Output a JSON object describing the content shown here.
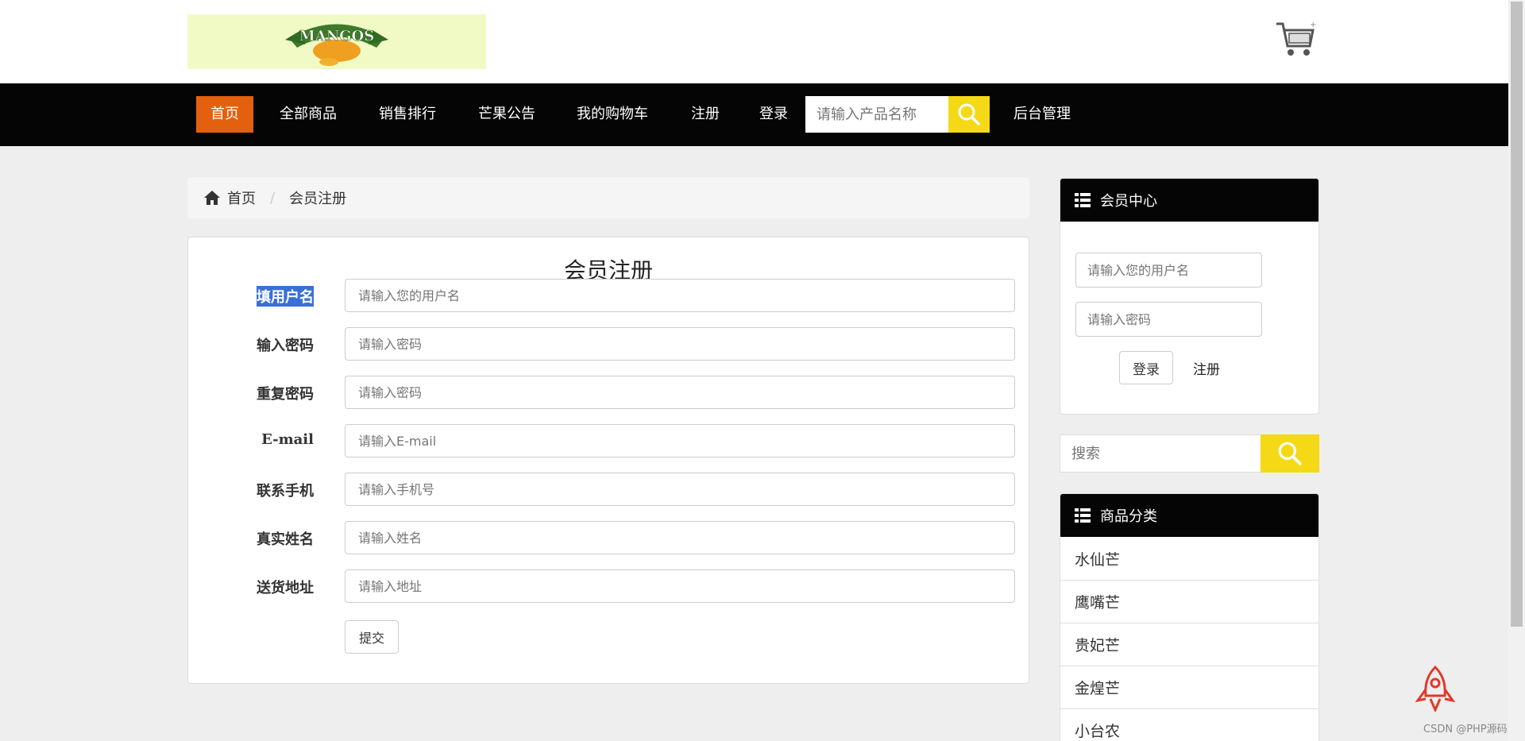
{
  "header": {
    "logo_text": "MANGOS",
    "cart_icon": "shopping-cart-icon"
  },
  "nav": {
    "items": [
      "首页",
      "全部商品",
      "销售排行",
      "芒果公告",
      "我的购物车",
      "注册",
      "登录"
    ],
    "search_placeholder": "请输入产品名称",
    "admin_label": "后台管理",
    "accent_color": "#e3600e",
    "search_button_color": "#f5d916"
  },
  "breadcrumb": {
    "home": "首页",
    "current": "会员注册"
  },
  "register": {
    "title": "会员注册",
    "fields": [
      {
        "label": "填用户名",
        "placeholder": "请输入您的用户名"
      },
      {
        "label": "输入密码",
        "placeholder": "请输入密码"
      },
      {
        "label": "重复密码",
        "placeholder": "请输入密码"
      },
      {
        "label": "E-mail",
        "placeholder": "请输入E-mail"
      },
      {
        "label": "联系手机",
        "placeholder": "请输入手机号"
      },
      {
        "label": "真实姓名",
        "placeholder": "请输入姓名"
      },
      {
        "label": "送货地址",
        "placeholder": "请输入地址"
      }
    ],
    "submit_label": "提交"
  },
  "member_center": {
    "title": "会员中心",
    "username_placeholder": "请输入您的用户名",
    "password_placeholder": "请输入密码",
    "login_label": "登录",
    "register_label": "注册"
  },
  "sidebar_search": {
    "placeholder": "搜索"
  },
  "categories": {
    "title": "商品分类",
    "items": [
      "水仙芒",
      "鹰嘴芒",
      "贵妃芒",
      "金煌芒",
      "小台农"
    ]
  },
  "watermark": "CSDN @PHP源码"
}
